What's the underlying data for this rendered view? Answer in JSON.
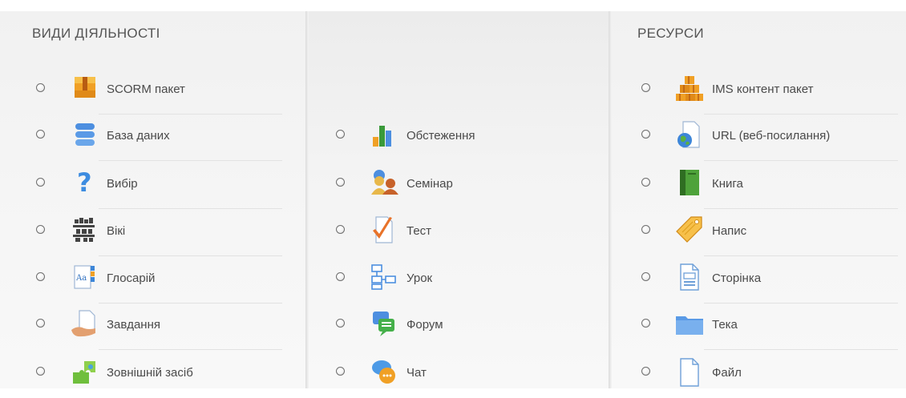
{
  "activities": {
    "heading": "ВИДИ ДІЯЛЬНОСТІ",
    "items": [
      {
        "label": "SCORM пакет",
        "icon": "scorm-package-icon"
      },
      {
        "label": "База даних",
        "icon": "database-icon"
      },
      {
        "label": "Вибір",
        "icon": "choice-question-icon"
      },
      {
        "label": "Вікі",
        "icon": "wiki-icon"
      },
      {
        "label": "Глосарій",
        "icon": "glossary-icon"
      },
      {
        "label": "Завдання",
        "icon": "assignment-icon"
      },
      {
        "label": "Зовнішній засіб",
        "icon": "external-tool-puzzle-icon"
      }
    ]
  },
  "middle": {
    "items": [
      {
        "label": "Обстеження",
        "icon": "survey-chart-icon"
      },
      {
        "label": "Семінар",
        "icon": "workshop-people-icon"
      },
      {
        "label": "Тест",
        "icon": "quiz-checkmark-icon"
      },
      {
        "label": "Урок",
        "icon": "lesson-flow-icon"
      },
      {
        "label": "Форум",
        "icon": "forum-bubbles-icon"
      },
      {
        "label": "Чат",
        "icon": "chat-bubble-icon"
      }
    ]
  },
  "resources": {
    "heading": "РЕСУРСИ",
    "items": [
      {
        "label": "IMS контент пакет",
        "icon": "ims-package-icon"
      },
      {
        "label": "URL (веб-посилання)",
        "icon": "url-globe-icon"
      },
      {
        "label": "Книга",
        "icon": "book-icon"
      },
      {
        "label": "Напис",
        "icon": "label-tag-icon"
      },
      {
        "label": "Сторінка",
        "icon": "page-document-icon"
      },
      {
        "label": "Тека",
        "icon": "folder-icon"
      },
      {
        "label": "Файл",
        "icon": "file-icon"
      }
    ]
  }
}
